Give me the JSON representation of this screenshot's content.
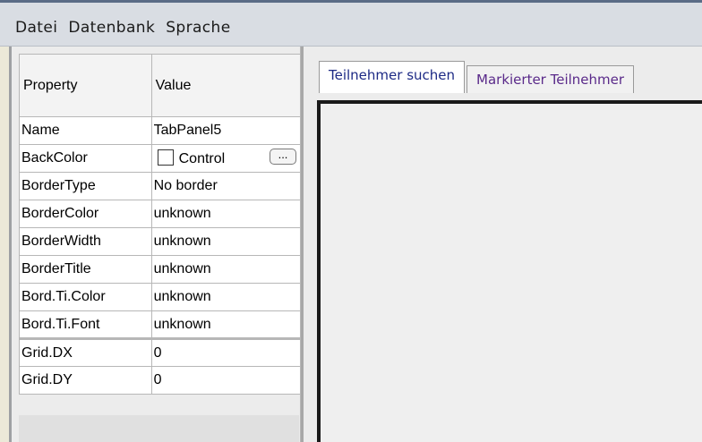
{
  "menubar": {
    "items": [
      "Datei",
      "Datenbank",
      "Sprache"
    ]
  },
  "properties": {
    "header_property": "Property",
    "header_value": "Value",
    "rows": [
      {
        "name": "Name",
        "value": "TabPanel5"
      },
      {
        "name": "BackColor",
        "value": "Control",
        "has_swatch": true,
        "button": "..."
      },
      {
        "name": "BorderType",
        "value": "No border"
      },
      {
        "name": "BorderColor",
        "value": "unknown"
      },
      {
        "name": "BorderWidth",
        "value": "unknown"
      },
      {
        "name": "BorderTitle",
        "value": "unknown"
      },
      {
        "name": "Bord.Ti.Color",
        "value": "unknown"
      },
      {
        "name": "Bord.Ti.Font",
        "value": "unknown"
      },
      {
        "name": "Grid.DX",
        "value": "0"
      },
      {
        "name": "Grid.DY",
        "value": "0"
      }
    ]
  },
  "tabs": [
    {
      "label": "Teilnehmer suchen",
      "active": true
    },
    {
      "label": "Markierter Teilnehmer",
      "active": false
    }
  ],
  "colors": {
    "active_tab_text": "#1d2a85",
    "inactive_tab_text": "#5a2a8a",
    "menubar_bg": "#d9dde3"
  }
}
